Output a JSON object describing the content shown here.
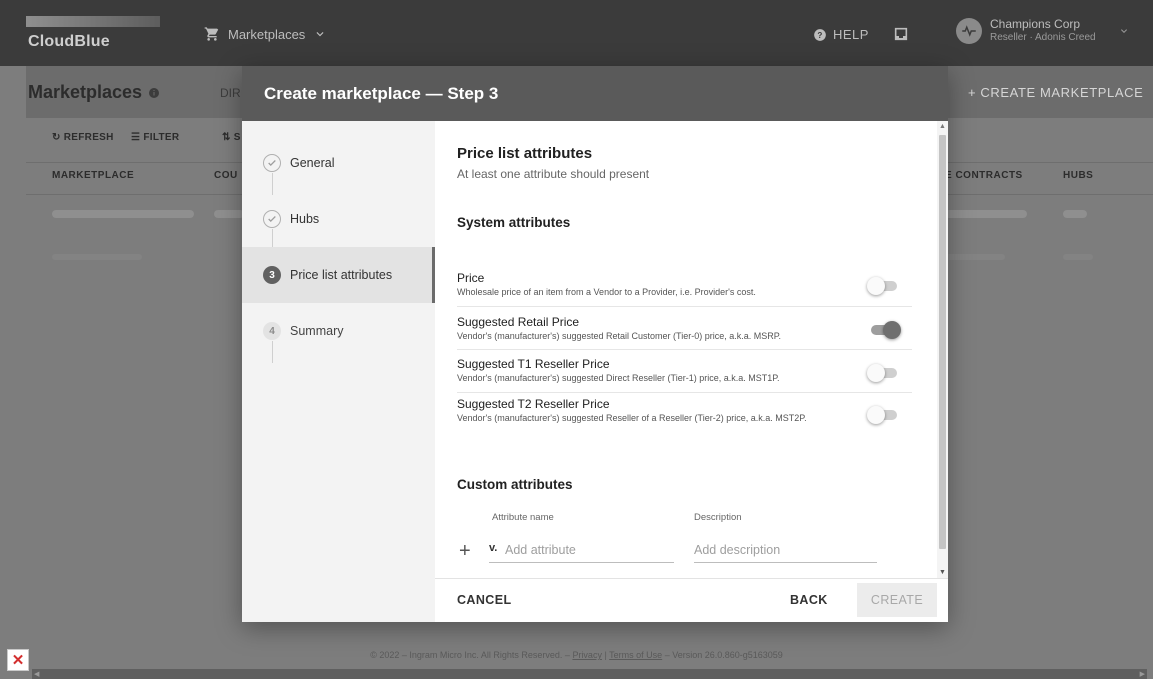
{
  "app": {
    "logo_text": "CloudBlue",
    "marketplaces_menu": "Marketplaces",
    "help_label": "HELP",
    "account_name": "Champions Corp",
    "account_role": "Reseller · Adonis Creed"
  },
  "page": {
    "title": "Marketplaces",
    "tab_partial": "DIR",
    "create_button": "+ CREATE MARKETPLACE",
    "toolbar": {
      "refresh": "REFRESH",
      "filter": "FILTER",
      "sort_partial": "S"
    },
    "columns": {
      "marketplace": "MARKETPLACE",
      "countries_partial": "COU",
      "contracts_partial": "E CONTRACTS",
      "hubs": "HUBS"
    },
    "footer": {
      "prefix": "© 2022 – Ingram Micro Inc. All Rights Reserved. –",
      "privacy": "Privacy",
      "separator": "|",
      "terms": "Terms of Use",
      "version": "– Version 26.0.860-g5163059"
    }
  },
  "modal": {
    "title": "Create marketplace — Step 3",
    "steps": [
      {
        "number": "",
        "label": "General",
        "state": "done"
      },
      {
        "number": "",
        "label": "Hubs",
        "state": "done"
      },
      {
        "number": "3",
        "label": "Price list attributes",
        "state": "current"
      },
      {
        "number": "4",
        "label": "Summary",
        "state": "todo"
      }
    ],
    "section_title": "Price list attributes",
    "section_subtitle": "At least one attribute should present",
    "system_title": "System attributes",
    "attributes": [
      {
        "name": "Price",
        "description": "Wholesale price of an item from a Vendor to a Provider, i.e. Provider's cost.",
        "enabled": false
      },
      {
        "name": "Suggested Retail Price",
        "description": "Vendor's (manufacturer's) suggested Retail Customer (Tier-0) price, a.k.a. MSRP.",
        "enabled": true
      },
      {
        "name": "Suggested T1 Reseller Price",
        "description": "Vendor's (manufacturer's) suggested Direct Reseller (Tier-1) price, a.k.a. MST1P.",
        "enabled": false
      },
      {
        "name": "Suggested T2 Reseller Price",
        "description": "Vendor's (manufacturer's) suggested Reseller of a Reseller (Tier-2) price, a.k.a. MST2P.",
        "enabled": false
      }
    ],
    "custom_title": "Custom attributes",
    "custom": {
      "name_header": "Attribute name",
      "description_header": "Description",
      "name_prefix": "v.",
      "name_placeholder": "Add attribute",
      "description_placeholder": "Add description"
    },
    "actions": {
      "cancel": "CANCEL",
      "back": "BACK",
      "create": "CREATE"
    }
  }
}
